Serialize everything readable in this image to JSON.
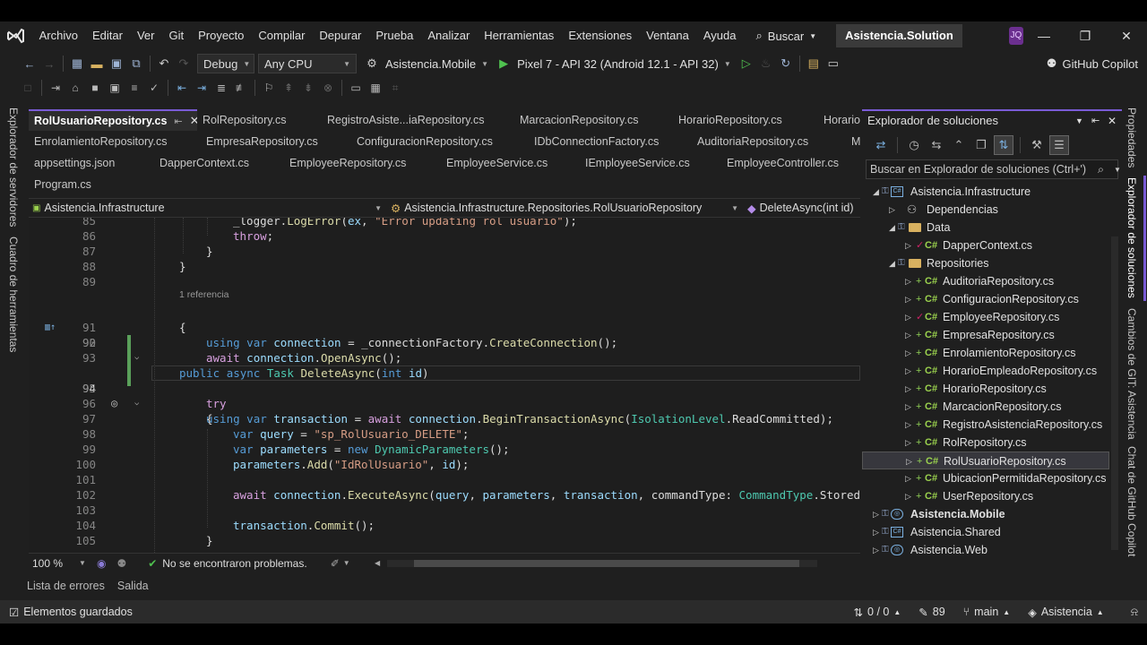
{
  "menu": {
    "items": [
      "Archivo",
      "Editar",
      "Ver",
      "Git",
      "Proyecto",
      "Compilar",
      "Depurar",
      "Prueba",
      "Analizar",
      "Herramientas",
      "Extensiones",
      "Ventana",
      "Ayuda"
    ],
    "search_label": "Buscar",
    "solution_title": "Asistencia.Solution",
    "avatar": "JQ"
  },
  "toolbar": {
    "config": "Debug",
    "platform": "Any CPU",
    "startup_project": "Asistencia.Mobile",
    "run_target": "Pixel 7 - API 32 (Android 12.1 - API 32)",
    "copilot": "GitHub Copilot"
  },
  "left_rail": [
    "Explorador de servidores",
    "Cuadro de herramientas"
  ],
  "right_rail": [
    "Propiedades",
    "Explorador de soluciones",
    "Cambios de GIT: Asistencia",
    "Chat de GitHub Copilot"
  ],
  "doc_tabs": {
    "row1": [
      "RolUsuarioRepository.cs",
      "RolRepository.cs",
      "RegistroAsiste...iaRepository.cs",
      "MarcacionRepository.cs",
      "HorarioRepository.cs",
      "Horario"
    ],
    "row2": [
      "EnrolamientoRepository.cs",
      "EmpresaRepository.cs",
      "ConfiguracionRepository.cs",
      "IDbConnectionFactory.cs",
      "AuditoriaRepository.cs",
      "M"
    ],
    "row3": [
      "appsettings.json",
      "DapperContext.cs",
      "EmployeeRepository.cs",
      "EmployeeService.cs",
      "IEmployeeService.cs",
      "EmployeeController.cs"
    ],
    "row4": [
      "Program.cs"
    ]
  },
  "navbar": {
    "project": "Asistencia.Infrastructure",
    "type": "Asistencia.Infrastructure.Repositories.RolUsuarioRepository",
    "member": "DeleteAsync(int id)"
  },
  "editor": {
    "ref_hint": "1 referencia",
    "line_numbers": [
      "85",
      "86",
      "87",
      "88",
      "89",
      "90",
      "91",
      "92",
      "93",
      "94",
      "95",
      "96",
      "97",
      "98",
      "99",
      "100",
      "101",
      "102",
      "103",
      "104",
      "105"
    ],
    "current_line": "94"
  },
  "editor_status": {
    "zoom": "100 %",
    "problems": "No se encontraron problemas."
  },
  "solution_explorer": {
    "title": "Explorador de soluciones",
    "search_placeholder": "Buscar en Explorador de soluciones (Ctrl+')",
    "tree": {
      "project": "Asistencia.Infrastructure",
      "dependencies": "Dependencias",
      "data_folder": "Data",
      "data_files": [
        "DapperContext.cs"
      ],
      "repos_folder": "Repositories",
      "repo_files": [
        "AuditoriaRepository.cs",
        "ConfiguracionRepository.cs",
        "EmployeeRepository.cs",
        "EmpresaRepository.cs",
        "EnrolamientoRepository.cs",
        "HorarioEmpleadoRepository.cs",
        "HorarioRepository.cs",
        "MarcacionRepository.cs",
        "RegistroAsistenciaRepository.cs",
        "RolRepository.cs",
        "RolUsuarioRepository.cs",
        "UbicacionPermitidaRepository.cs",
        "UserRepository.cs"
      ],
      "other_projects": [
        "Asistencia.Mobile",
        "Asistencia.Shared",
        "Asistencia.Web"
      ]
    }
  },
  "bottom_tabs": [
    "Lista de errores",
    "Salida"
  ],
  "status_bar": {
    "left": "Elementos guardados",
    "sync": "0 / 0",
    "edits": "89",
    "branch": "main",
    "repo": "Asistencia"
  }
}
